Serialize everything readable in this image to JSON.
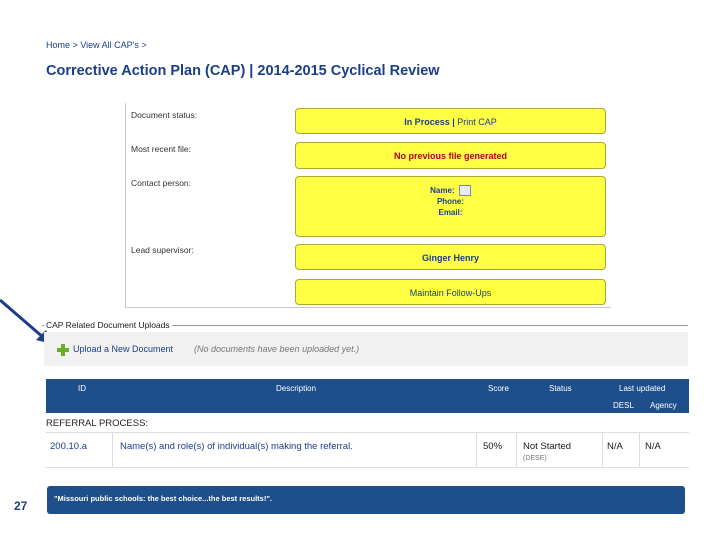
{
  "breadcrumb": {
    "home": "Home",
    "sep1": ">",
    "view_all": "View All CAP's",
    "sep2": ">"
  },
  "page_title": "Corrective Action Plan (CAP) | 2014-2015 Cyclical Review",
  "details": {
    "document_status_label": "Document status:",
    "document_status_value": "In Process",
    "document_status_sep": "|",
    "print_cap_label": "Print CAP",
    "most_recent_file_label": "Most recent file:",
    "most_recent_file_value": "No previous file generated",
    "contact_person_label": "Contact person:",
    "contact_name_label": "Name:",
    "contact_phone_label": "Phone:",
    "contact_email_label": "Email:",
    "lead_supervisor_label": "Lead supervisor:",
    "lead_supervisor_value": "Ginger Henry",
    "maintain_followups_label": "Maintain Follow-Ups"
  },
  "uploads": {
    "legend": "CAP Related Document Uploads",
    "upload_link": "Upload a New Document",
    "empty_note": "(No documents have been uploaded yet.)"
  },
  "table": {
    "headers": {
      "id": "ID",
      "description": "Description",
      "score": "Score",
      "status": "Status",
      "last_updated": "Last updated",
      "desl": "DESL",
      "agency": "Agency"
    },
    "section": "REFERRAL PROCESS:",
    "rows": [
      {
        "id": "200.10.a",
        "description": "Name(s) and role(s) of individual(s) making the referral.",
        "score": "50%",
        "status": "Not Started",
        "status_sub": "(DESE)",
        "desl": "N/A",
        "agency": "N/A"
      }
    ]
  },
  "footer": {
    "tagline": "\"Missouri public schools: the best choice...the best results!\"."
  },
  "slide_number": "27",
  "colors": {
    "accent": "#1f4f8b",
    "highlight": "#ffff44",
    "link": "#1c3d8c",
    "alert": "#b3001b",
    "add": "#6aad28"
  },
  "icons": {
    "upload": "plus-icon",
    "contact_note": "note-icon",
    "pointer": "arrow-icon"
  }
}
